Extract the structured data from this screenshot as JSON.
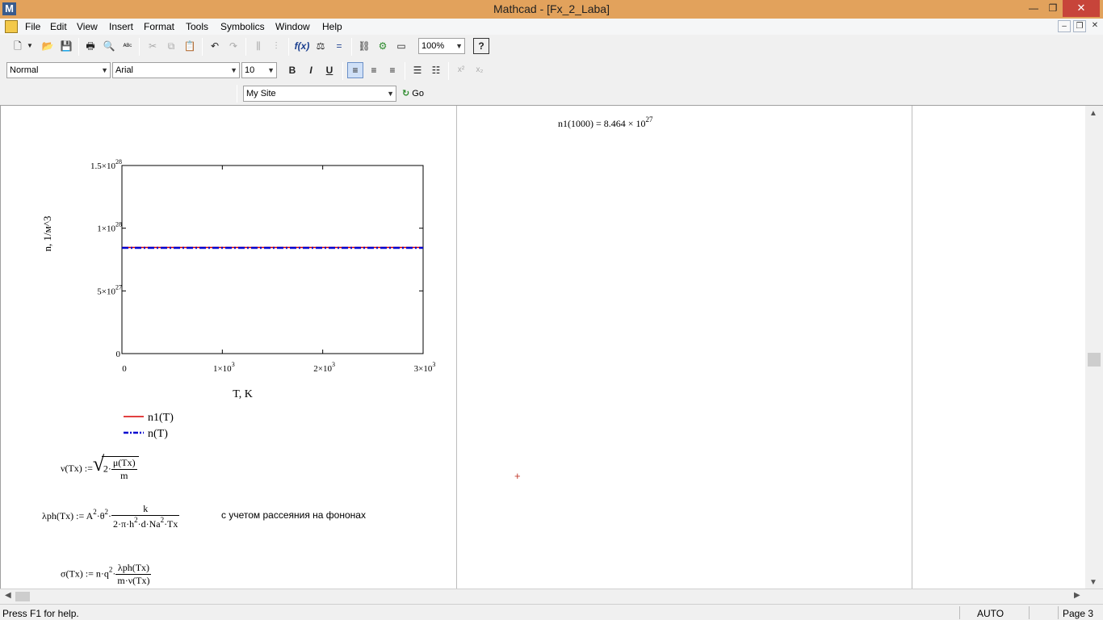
{
  "window": {
    "title": "Mathcad - [Fx_2_Laba]",
    "app_icon": "M"
  },
  "menu": [
    {
      "label": "File",
      "u": "F"
    },
    {
      "label": "Edit",
      "u": "E"
    },
    {
      "label": "View",
      "u": "V"
    },
    {
      "label": "Insert",
      "u": "I"
    },
    {
      "label": "Format",
      "u": "o"
    },
    {
      "label": "Tools",
      "u": "T"
    },
    {
      "label": "Symbolics",
      "u": "S"
    },
    {
      "label": "Window",
      "u": "W"
    },
    {
      "label": "Help",
      "u": "H"
    }
  ],
  "toolbar": {
    "zoom": "100%",
    "style": "Normal",
    "font": "Arial",
    "font_size": "10",
    "site": "My Site",
    "go_label": "Go",
    "bold": "B",
    "italic": "I",
    "underline": "U"
  },
  "status": {
    "help": "Press F1 for help.",
    "mode": "AUTO",
    "page": "Page 3"
  },
  "chart_data": {
    "type": "line",
    "xlabel": "T, K",
    "ylabel": "n, 1/м^3",
    "xlim": [
      0,
      3000
    ],
    "ylim": [
      0,
      1.5e+28
    ],
    "x_ticks": [
      "0",
      "1×10",
      "2×10",
      "3×10"
    ],
    "x_tick_exp": [
      "",
      "3",
      "3",
      "3"
    ],
    "y_ticks": [
      "0",
      "5×10",
      "1×10",
      "1.5×10"
    ],
    "y_tick_exp": [
      "",
      "27",
      "28",
      "28"
    ],
    "series": [
      {
        "name": "n1(T)",
        "color": "#d90000",
        "style": "solid",
        "x": [
          0,
          3000
        ],
        "y": [
          8.464e+27,
          8.464e+27
        ]
      },
      {
        "name": "n(T)",
        "color": "#0000d0",
        "style": "dashdot",
        "x": [
          0,
          3000
        ],
        "y": [
          8.43e+27,
          8.43e+27
        ]
      }
    ]
  },
  "result": {
    "expr": "n1(1000) = 8.464 × 10",
    "exp": "27"
  },
  "formulas": {
    "nu_lhs": "ν(Tx) :=",
    "nu_coef": "2·",
    "nu_num": "μ(Tx)",
    "nu_den": "m",
    "lph_lhs": "λph(Tx) :=",
    "lph_A": "A",
    "lph_exp1": "2",
    "lph_theta": "·θ",
    "lph_exp2": "2",
    "lph_dot": "·",
    "lph_num": "k",
    "lph_den_a": "2·π·h",
    "lph_den_exp": "2",
    "lph_den_b": "·d·Na",
    "lph_den_exp2": "2",
    "lph_den_c": "·Tx",
    "lph_comment": "с учетом рассеяния на фононах",
    "sigma_lhs": "σ(Tx) :=",
    "sigma_pre": "n·q",
    "sigma_exp": "2",
    "sigma_dot": "·",
    "sigma_num": "λph(Tx)",
    "sigma_den": "m·ν(Tx)"
  }
}
